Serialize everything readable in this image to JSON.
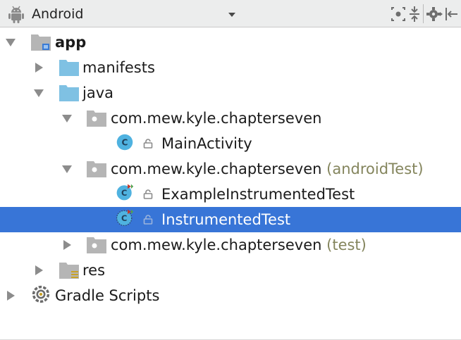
{
  "toolbar": {
    "view_label": "Android",
    "icons": [
      "android-icon",
      "dropdown-arrow-icon",
      "scroll-from-source-icon",
      "collapse-all-icon",
      "settings-gear-icon",
      "hide-panel-icon"
    ]
  },
  "tree": [
    {
      "label": "app",
      "suffix": "",
      "icon": "module-folder-icon",
      "expanded": true
    },
    {
      "label": "manifests",
      "suffix": "",
      "icon": "folder-icon",
      "expanded": false
    },
    {
      "label": "java",
      "suffix": "",
      "icon": "folder-icon",
      "expanded": true
    },
    {
      "label": "com.mew.kyle.chapterseven",
      "suffix": "",
      "icon": "package-icon",
      "expanded": true
    },
    {
      "label": "MainActivity",
      "suffix": "",
      "icon": "class-icon"
    },
    {
      "label": "com.mew.kyle.chapterseven",
      "suffix": " (androidTest)",
      "icon": "package-icon",
      "expanded": true
    },
    {
      "label": "ExampleInstrumentedTest",
      "suffix": "",
      "icon": "test-class-icon"
    },
    {
      "label": "InstrumentedTest",
      "suffix": "",
      "icon": "test-class-icon",
      "selected": true
    },
    {
      "label": "com.mew.kyle.chapterseven",
      "suffix": " (test)",
      "icon": "package-icon",
      "expanded": false
    },
    {
      "label": "res",
      "suffix": "",
      "icon": "resource-folder-icon",
      "expanded": false
    },
    {
      "label": "Gradle Scripts",
      "suffix": "",
      "icon": "gradle-icon",
      "expanded": false
    }
  ],
  "colors": {
    "selection": "#3875d7",
    "folder": "#7fc1e3",
    "class_badge": "#4fb2e0",
    "suffix_text": "#84855d"
  }
}
